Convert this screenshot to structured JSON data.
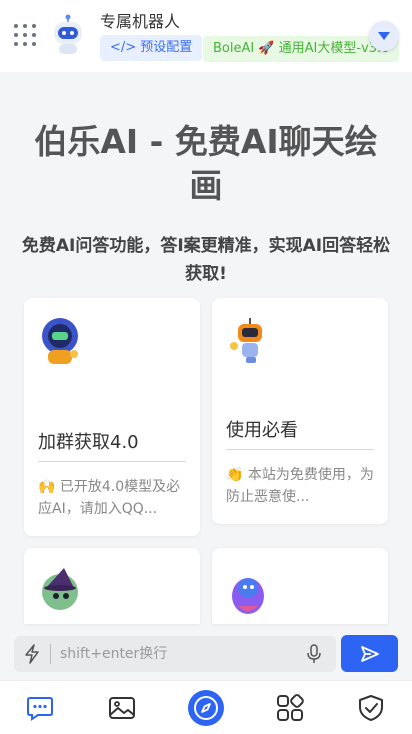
{
  "header": {
    "bot_name": "专属机器人",
    "preset_label": "</> 预设配置",
    "model_label": "BoleAI 🚀 通用AI大模型-v3.0"
  },
  "hero": {
    "title": "伯乐AI - 免费AI聊天绘画",
    "subtitle": "免费AI问答功能，答I案更精准，实现AI回答轻松获取!"
  },
  "cards": [
    {
      "title": "加群获取4.0",
      "desc": "🙌 已开放4.0模型及必应AI，请加入QQ..."
    },
    {
      "title": "使用必看",
      "desc": "👏 本站为免费使用，为防止恶意使..."
    }
  ],
  "input": {
    "placeholder": "shift+enter换行"
  },
  "nav": [
    "chat",
    "image",
    "discover",
    "apps",
    "shield"
  ],
  "colors": {
    "accent": "#2e64f4",
    "model_tag_text": "#48b33a",
    "preset_text": "#3a6df0"
  }
}
